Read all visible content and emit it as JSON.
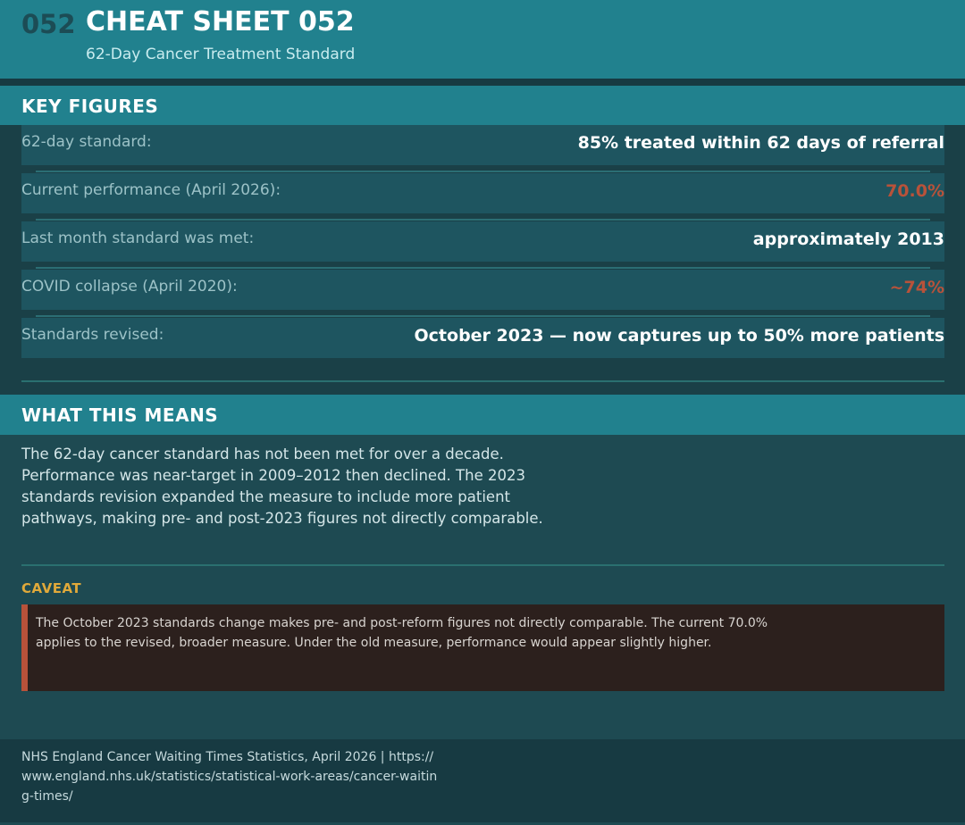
{
  "header": {
    "number": "052",
    "title": "CHEAT SHEET 052",
    "subtitle": "62-Day Cancer Treatment Standard"
  },
  "key_figures": {
    "heading": "KEY FIGURES",
    "rows": [
      {
        "label": "62-day standard:",
        "value": "85% treated within 62 days of referral",
        "highlight": false
      },
      {
        "label": "Current performance (April 2026):",
        "value": "70.0%",
        "highlight": true
      },
      {
        "label": "Last month standard was met:",
        "value": "approximately 2013",
        "highlight": false
      },
      {
        "label": "COVID collapse (April 2020):",
        "value": "~74%",
        "highlight": true
      },
      {
        "label": "Standards revised:",
        "value": "October 2023 — now captures up to 50% more patients",
        "highlight": false
      }
    ]
  },
  "meaning": {
    "heading": "WHAT THIS MEANS",
    "text": "The 62-day cancer standard has not been met for over a decade. Performance was near-target in 2009–2012 then declined. The 2023 standards revision expanded the measure to include more patient pathways, making pre- and post-2023 figures not directly comparable."
  },
  "caveat": {
    "heading": "CAVEAT",
    "text": "The October 2023 standards change makes pre- and post-reform figures not directly comparable. The current 70.0% applies to the revised, broader measure. Under the old measure, performance would appear slightly higher."
  },
  "footer": {
    "source": "NHS England Cancer Waiting Times Statistics, April 2026 | https://www.england.nhs.uk/statistics/statistical-work-areas/cancer-waiting-times/"
  },
  "colors": {
    "accent": "#21818e",
    "alert": "#b8523a",
    "caveat_heading": "#e0a93a",
    "background": "#1e4a52"
  }
}
